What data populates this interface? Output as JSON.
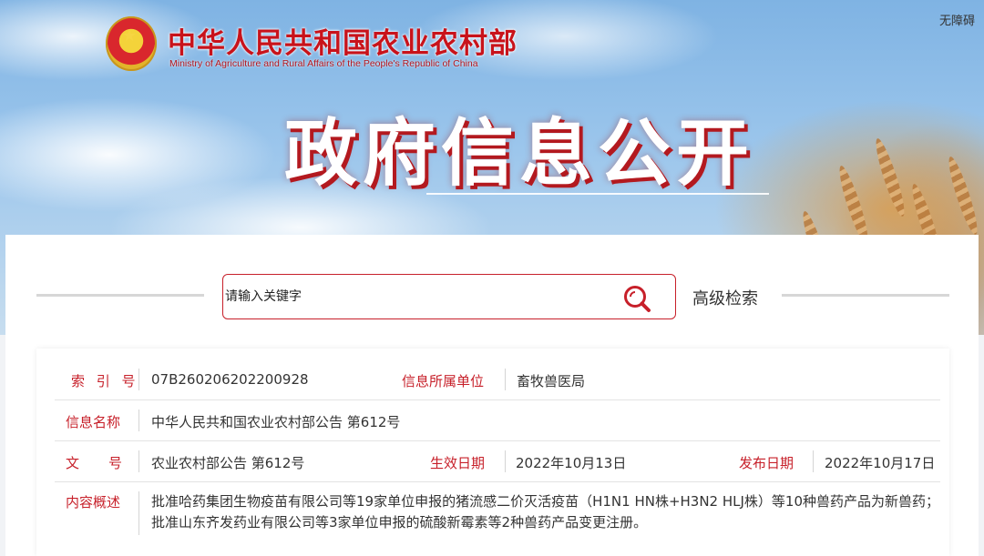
{
  "header": {
    "ministry_cn": "中华人民共和国农业农村部",
    "ministry_en": "Ministry of Agriculture and Rural Affairs of the People's Republic of China",
    "accessibility_link": "无障碍",
    "page_title": "政府信息公开"
  },
  "search": {
    "placeholder": "请输入关键字",
    "advanced_label": "高级检索"
  },
  "colors": {
    "accent_red": "#c7202a",
    "label_red": "#c7202a",
    "text": "#333333"
  },
  "record": {
    "index_label": "索 引 号",
    "index_value": "07B260206202200928",
    "unit_label": "信息所属单位",
    "unit_value": "畜牧兽医局",
    "name_label": "信息名称",
    "name_value": "中华人民共和国农业农村部公告 第612号",
    "doc_no_label_1": "文",
    "doc_no_label_2": "号",
    "doc_no_value": "农业农村部公告 第612号",
    "effective_label": "生效日期",
    "effective_value": "2022年10月13日",
    "publish_label": "发布日期",
    "publish_value": "2022年10月17日",
    "summary_label": "内容概述",
    "summary_value": "批准哈药集团生物疫苗有限公司等19家单位申报的猪流感二价灭活疫苗（H1N1 HN株+H3N2 HLJ株）等10种兽药产品为新兽药；批准山东齐发药业有限公司等3家单位申报的硫酸新霉素等2种兽药产品变更注册。"
  }
}
